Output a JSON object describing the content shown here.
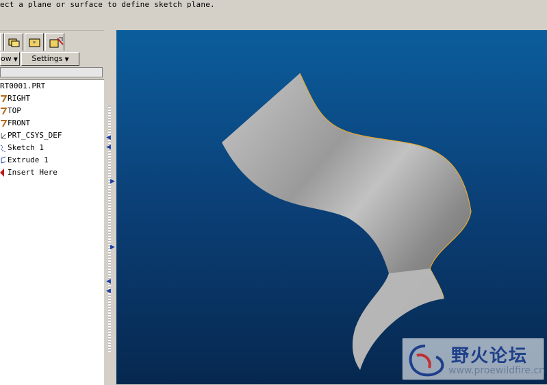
{
  "message_bar": {
    "text": "ect a plane or surface to define sketch plane."
  },
  "navigator": {
    "tabs": [
      {
        "name": "model-tree-tab-icon"
      },
      {
        "name": "folder-browser-tab-icon"
      },
      {
        "name": "favorites-tab-icon"
      },
      {
        "name": "connections-tab-icon"
      }
    ],
    "show_label": "ow",
    "settings_label": "Settings"
  },
  "model_tree": {
    "items": [
      {
        "label": "RT0001.PRT",
        "icon": "part-icon"
      },
      {
        "label": "RIGHT",
        "icon": "datum-plane-icon"
      },
      {
        "label": "TOP",
        "icon": "datum-plane-icon"
      },
      {
        "label": "FRONT",
        "icon": "datum-plane-icon"
      },
      {
        "label": "PRT_CSYS_DEF",
        "icon": "coordinate-system-icon"
      },
      {
        "label": "Sketch 1",
        "icon": "sketch-icon"
      },
      {
        "label": "Extrude 1",
        "icon": "extrude-icon"
      },
      {
        "label": "Insert Here",
        "icon": "insert-here-icon"
      }
    ]
  },
  "watermark": {
    "title": "野火论坛",
    "url": "www.proewildfire.cn"
  },
  "colors": {
    "viewport_top": "#0b5d9c",
    "viewport_bottom": "#06284f",
    "surface": "#b4b4b4",
    "edge": "#e6a828",
    "datum_plane": "#b06a1a",
    "insert_marker": "#c01818"
  }
}
